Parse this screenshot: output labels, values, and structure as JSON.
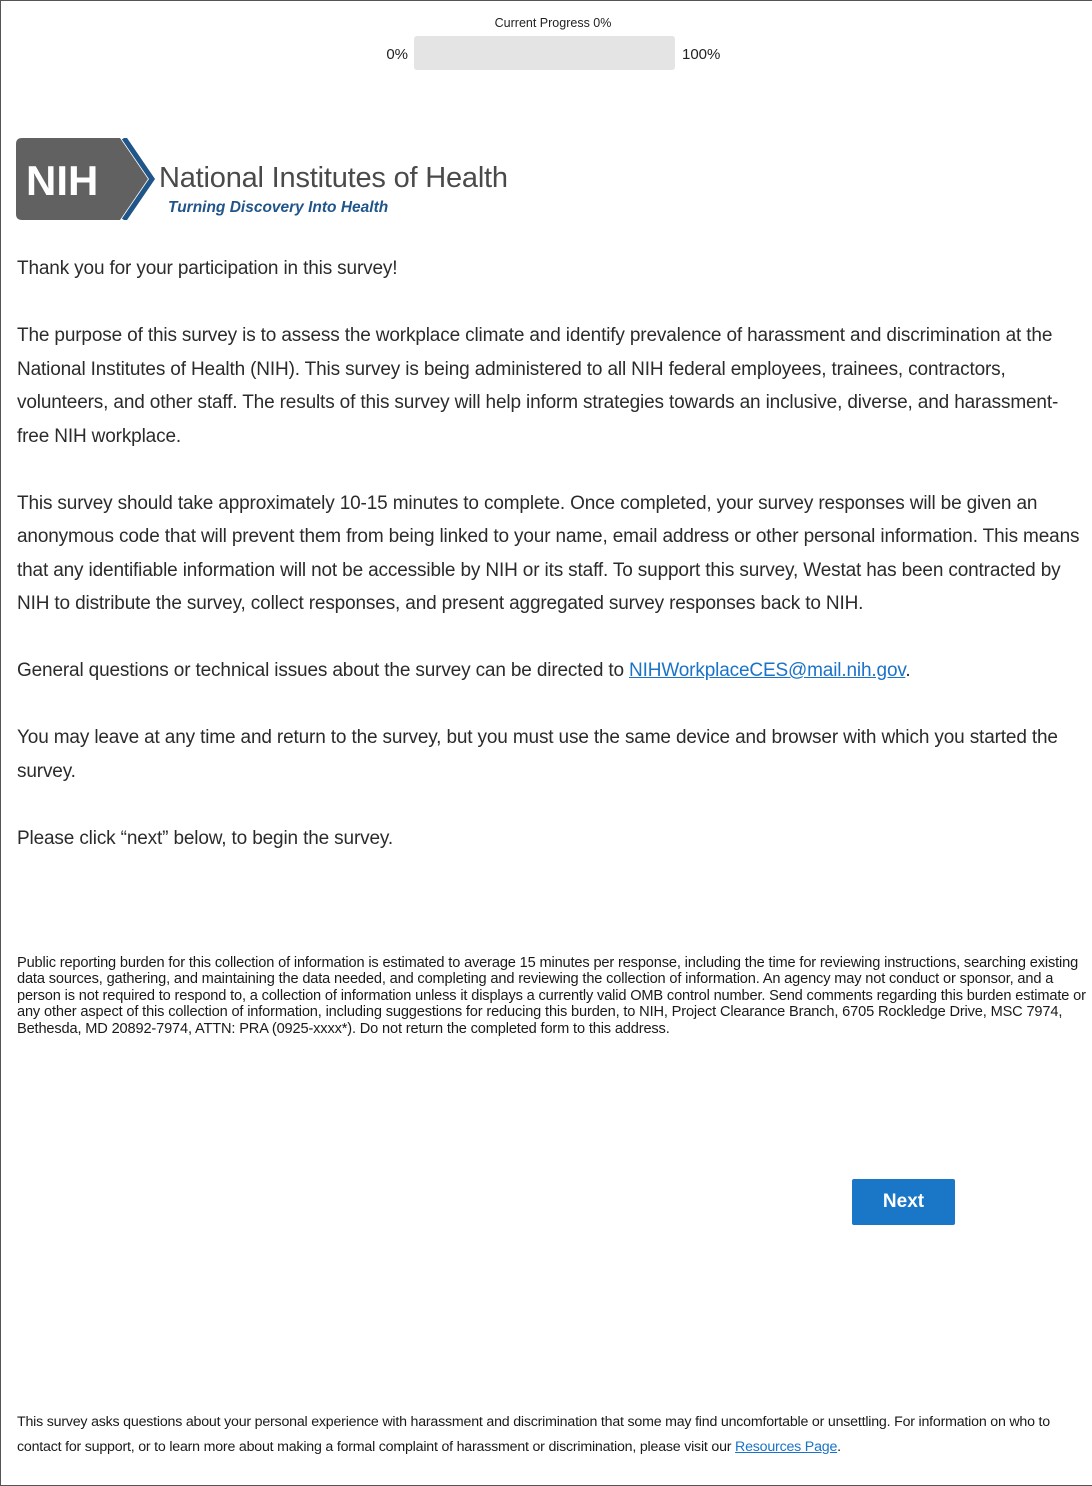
{
  "progress": {
    "title": "Current Progress 0%",
    "min_label": "0%",
    "max_label": "100%",
    "value_fraction": 0.0,
    "fill_color": "#1976bf"
  },
  "logo": {
    "badge_text": "NIH",
    "name": "National Institutes of Health",
    "tagline": "Turning Discovery Into Health"
  },
  "intro": {
    "thanks": "Thank you for your participation in this survey!",
    "purpose": "The purpose of this survey is to assess the workplace climate and identify prevalence of harassment and discrimination at the National Institutes of Health (NIH). This survey is being administered to all NIH federal employees, trainees, contractors, volunteers, and other staff. The results of this survey will help inform strategies towards an inclusive, diverse, and harassment-free NIH workplace.",
    "duration": "This survey should take approximately 10-15 minutes to complete. Once completed, your survey responses will be given an anonymous code that will prevent them from being linked to your name, email address or other personal information. This means that any identifiable information will not be accessible by NIH or its staff. To support this survey, Westat has been contracted by NIH to distribute the survey, collect responses, and present aggregated survey responses back to NIH.",
    "questions_prefix": "General questions or technical issues about the survey can be directed to ",
    "questions_email": "NIHWorkplaceCES@mail.nih.gov",
    "questions_suffix": ".",
    "leave": "You may leave at any time and return to the survey, but you must use the same device and browser with which you started the survey.",
    "begin": "Please click “next” below, to begin the survey."
  },
  "burden": "Public reporting burden for this collection of information is estimated to average 15 minutes per response, including the time for reviewing instructions, searching existing data sources, gathering, and maintaining the data needed, and completing and reviewing the collection of information. An agency may not conduct or sponsor, and a person is not required to respond to, a collection of information unless it displays a currently valid OMB control number. Send comments regarding this burden estimate or any other aspect of this collection of information, including suggestions for reducing this burden, to NIH, Project Clearance Branch, 6705 Rockledge Drive, MSC 7974, Bethesda, MD 20892-7974, ATTN: PRA (0925-xxxx*). Do not return the completed form to this address.",
  "next_button": {
    "label": "Next",
    "color": "#1a76c6"
  },
  "footer": {
    "text": "This survey asks questions about your personal experience with harassment and discrimination that some may find uncomfortable or unsettling. For information on who to contact for support, or to learn more about making a formal complaint of harassment or discrimination, please visit our ",
    "link": "Resources Page",
    "suffix": "."
  }
}
